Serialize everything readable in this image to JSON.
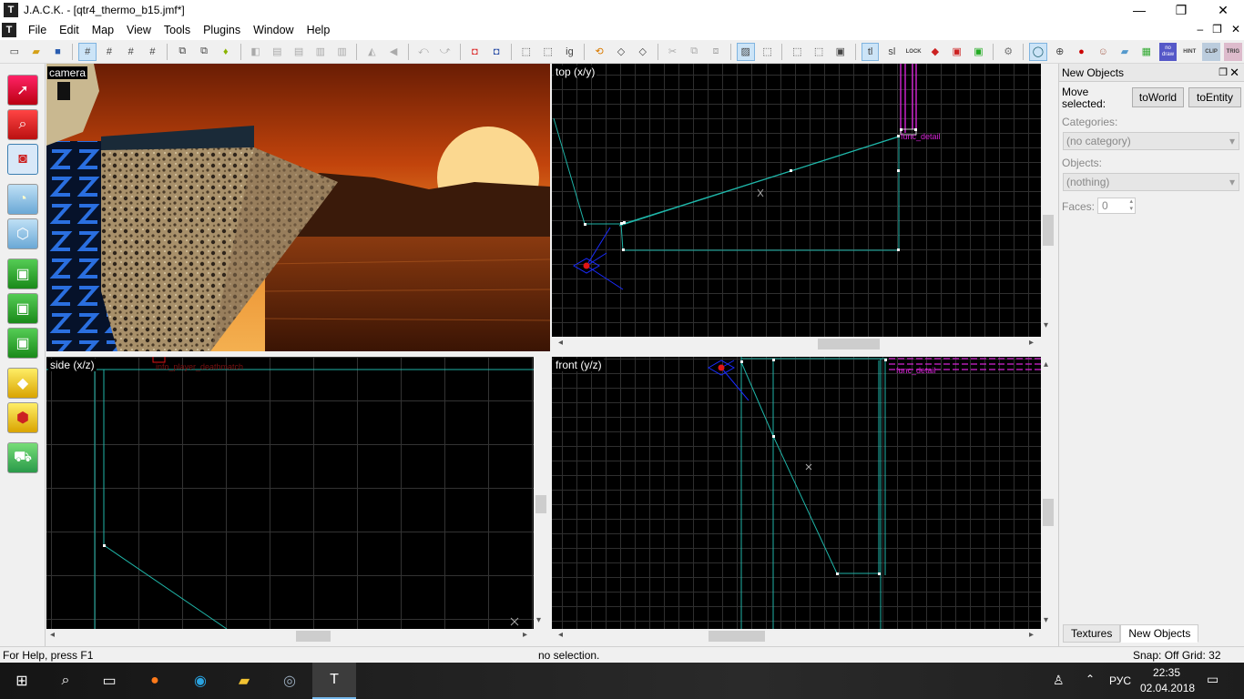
{
  "app": {
    "title": "J.A.C.K. - [qtr4_thermo_b15.jmf*]",
    "window_controls": [
      "—",
      "❐",
      "✕"
    ],
    "mdi_controls": [
      "–",
      "❐",
      "✕"
    ]
  },
  "menu": {
    "items": [
      "File",
      "Edit",
      "Map",
      "View",
      "Tools",
      "Plugins",
      "Window",
      "Help"
    ]
  },
  "toolbar": {
    "text_buttons": {
      "ig": "ig",
      "tl": "tl",
      "sl": "sl",
      "lock": "LOCK",
      "nodraw": "no draw",
      "hint": "HINT",
      "clip": "CLIP",
      "trig": "TRIG"
    }
  },
  "views": {
    "camera": {
      "label": "camera"
    },
    "top": {
      "label": "top (x/y)",
      "entity_label": "func_detail"
    },
    "side": {
      "label": "side (x/z)",
      "entity_label": "info_player_deathmatch"
    },
    "front": {
      "label": "front (y/z)",
      "entity_label": "func_detail"
    }
  },
  "right_panel": {
    "title": "New Objects",
    "move_selected_label": "Move selected:",
    "to_world_button": "toWorld",
    "to_entity_button": "toEntity",
    "categories_label": "Categories:",
    "categories_value": "(no category)",
    "objects_label": "Objects:",
    "objects_value": "(nothing)",
    "faces_label": "Faces:",
    "faces_value": "0",
    "tabs": [
      "Textures",
      "New Objects"
    ]
  },
  "status": {
    "help": "For Help, press F1",
    "selection": "no selection.",
    "snap": "Snap: Off Grid: 32"
  },
  "taskbar": {
    "lang": "РУС",
    "time": "22:35",
    "date": "02.04.2018"
  },
  "colors": {
    "brush_line": "#1fb5a8",
    "entity_magenta": "#d424d4",
    "player_blue": "#1a2cff",
    "player_red": "#e01515"
  }
}
